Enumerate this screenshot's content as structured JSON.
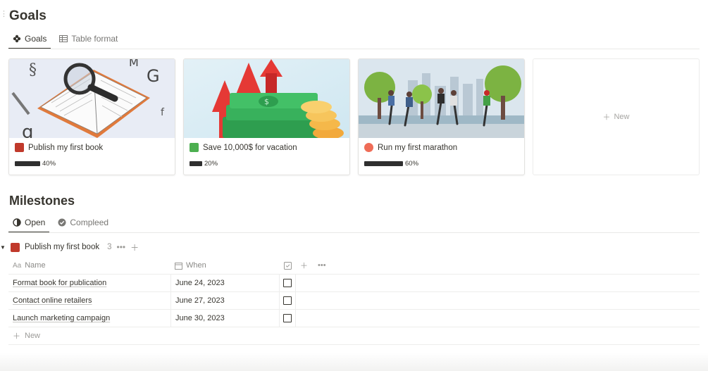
{
  "goals_section": {
    "title": "Goals",
    "tabs": [
      {
        "label": "Goals",
        "icon": "flower-icon",
        "active": true
      },
      {
        "label": "Table format",
        "icon": "table-icon",
        "active": false
      }
    ]
  },
  "goal_cards": [
    {
      "title": "Publish my first book",
      "emoji": "red-book-icon",
      "progress_label": "40%",
      "progress": 0.4
    },
    {
      "title": "Save 10,000$ for vacation",
      "emoji": "chart-money-icon",
      "progress_label": "20%",
      "progress": 0.2
    },
    {
      "title": "Run my first marathon",
      "emoji": "runner-icon",
      "progress_label": "60%",
      "progress": 0.6
    }
  ],
  "new_card_label": "New",
  "milestones_section": {
    "title": "Milestones",
    "tabs": [
      {
        "label": "Open",
        "icon": "half-circle-icon",
        "active": true
      },
      {
        "label": "Compleed",
        "icon": "check-circle-icon",
        "active": false
      }
    ]
  },
  "group": {
    "title": "Publish my first book",
    "count": "3",
    "emoji": "red-book-icon"
  },
  "table": {
    "headers": {
      "name_icon": "Aa",
      "name": "Name",
      "when": "When"
    },
    "rows": [
      {
        "name": "Format book for publication",
        "when": "June 24, 2023",
        "done": false
      },
      {
        "name": "Contact online retailers",
        "when": "June 27, 2023",
        "done": false
      },
      {
        "name": "Launch marketing campaign",
        "when": "June 30, 2023",
        "done": false
      }
    ],
    "new_label": "New"
  },
  "colors": {
    "text": "#37352f",
    "muted": "#9b9a97",
    "progress_bar": "#2f2f2f",
    "book_red": "#c0392b"
  }
}
